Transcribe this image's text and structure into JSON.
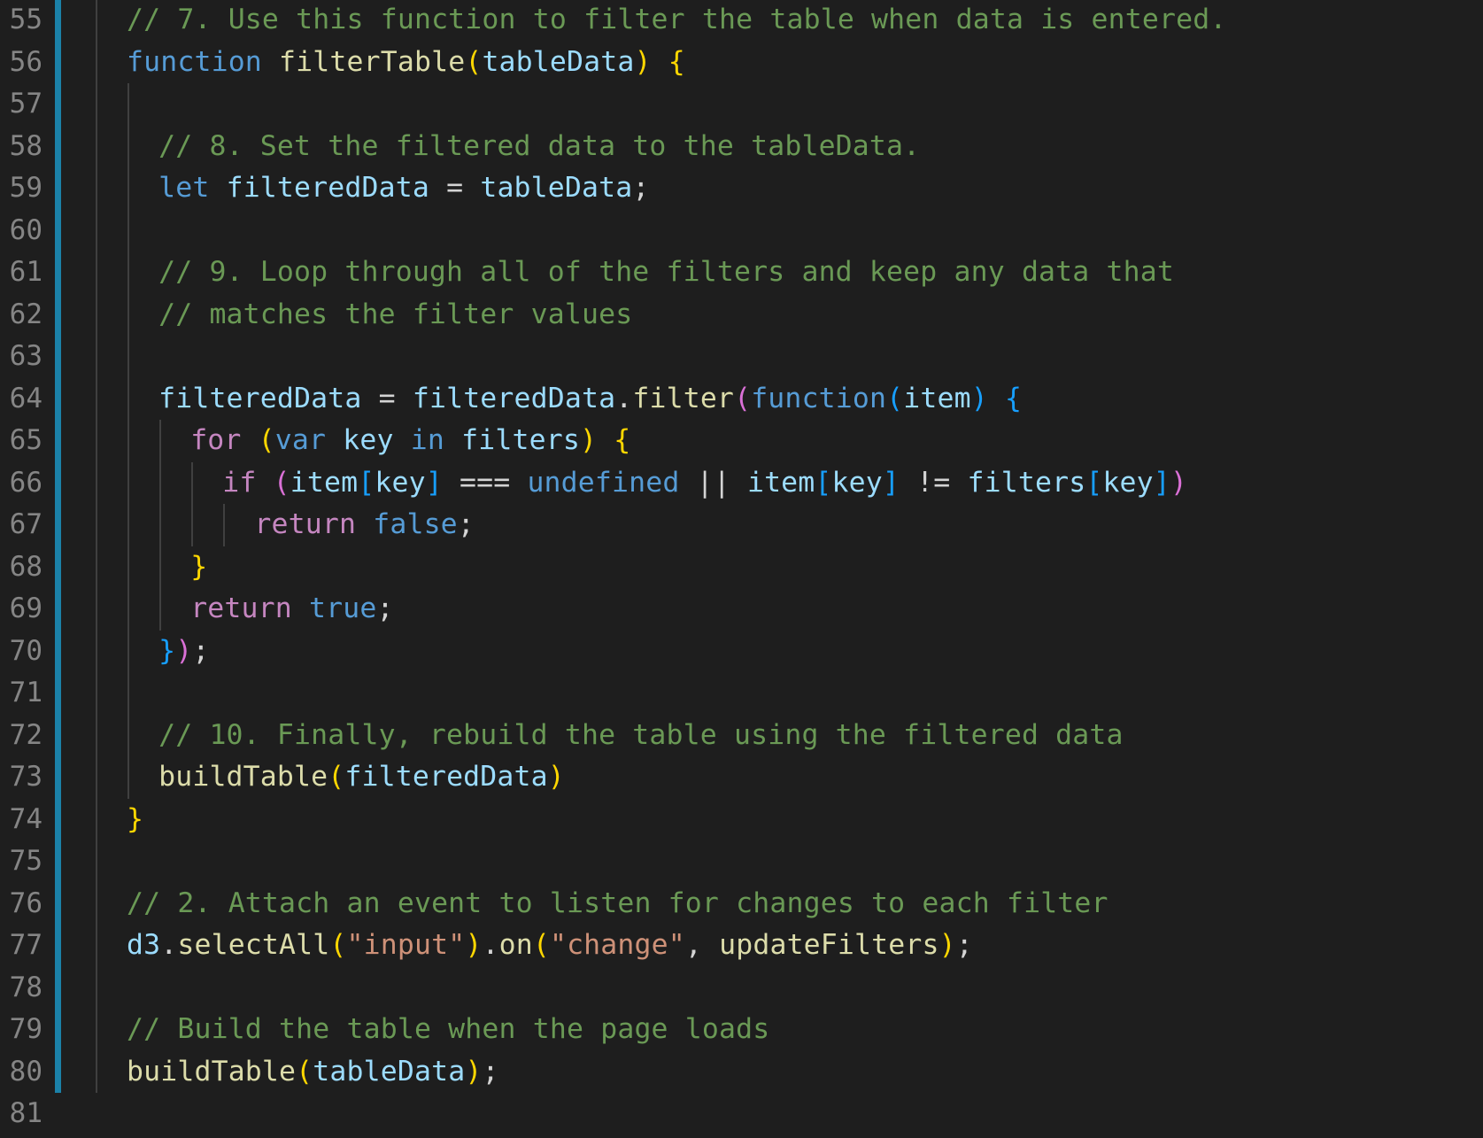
{
  "editor": {
    "colors": {
      "background": "#1e1e1e",
      "comment": "#6a9955",
      "keyword": "#569cd6",
      "control": "#c586c0",
      "variable": "#9cdcfe",
      "function": "#dcdcaa",
      "string": "#ce9178",
      "line_number": "#858585",
      "modified_gutter": "#1b81a8"
    },
    "lines": [
      {
        "num": "55",
        "gutter": "modified",
        "indent": 1,
        "tokens": [
          {
            "t": "c",
            "v": "// 7. Use this function to filter the table when data is entered."
          }
        ]
      },
      {
        "num": "56",
        "gutter": "modified",
        "indent": 1,
        "tokens": [
          {
            "t": "k",
            "v": "function"
          },
          {
            "t": "p",
            "v": " "
          },
          {
            "t": "f",
            "v": "filterTable"
          },
          {
            "t": "b1",
            "v": "("
          },
          {
            "t": "v",
            "v": "tableData"
          },
          {
            "t": "b1",
            "v": ")"
          },
          {
            "t": "p",
            "v": " "
          },
          {
            "t": "b1",
            "v": "{"
          }
        ]
      },
      {
        "num": "57",
        "gutter": "modified",
        "indent": 2,
        "tokens": []
      },
      {
        "num": "58",
        "gutter": "modified",
        "indent": 2,
        "tokens": [
          {
            "t": "c",
            "v": "// 8. Set the filtered data to the tableData."
          }
        ]
      },
      {
        "num": "59",
        "gutter": "modified",
        "indent": 2,
        "tokens": [
          {
            "t": "k",
            "v": "let"
          },
          {
            "t": "p",
            "v": " "
          },
          {
            "t": "v",
            "v": "filteredData"
          },
          {
            "t": "p",
            "v": " = "
          },
          {
            "t": "v",
            "v": "tableData"
          },
          {
            "t": "p",
            "v": ";"
          }
        ]
      },
      {
        "num": "60",
        "gutter": "modified",
        "indent": 2,
        "tokens": []
      },
      {
        "num": "61",
        "gutter": "modified",
        "indent": 2,
        "tokens": [
          {
            "t": "c",
            "v": "// 9. Loop through all of the filters and keep any data that"
          }
        ]
      },
      {
        "num": "62",
        "gutter": "modified",
        "indent": 2,
        "tokens": [
          {
            "t": "c",
            "v": "// matches the filter values"
          }
        ]
      },
      {
        "num": "63",
        "gutter": "modified",
        "indent": 2,
        "tokens": []
      },
      {
        "num": "64",
        "gutter": "modified",
        "indent": 2,
        "tokens": [
          {
            "t": "v",
            "v": "filteredData"
          },
          {
            "t": "p",
            "v": " = "
          },
          {
            "t": "v",
            "v": "filteredData"
          },
          {
            "t": "p",
            "v": "."
          },
          {
            "t": "f",
            "v": "filter"
          },
          {
            "t": "b2",
            "v": "("
          },
          {
            "t": "k",
            "v": "function"
          },
          {
            "t": "b3",
            "v": "("
          },
          {
            "t": "v",
            "v": "item"
          },
          {
            "t": "b3",
            "v": ")"
          },
          {
            "t": "p",
            "v": " "
          },
          {
            "t": "b3",
            "v": "{"
          }
        ]
      },
      {
        "num": "65",
        "gutter": "modified",
        "indent": 3,
        "tokens": [
          {
            "t": "kc",
            "v": "for"
          },
          {
            "t": "p",
            "v": " "
          },
          {
            "t": "b1",
            "v": "("
          },
          {
            "t": "k",
            "v": "var"
          },
          {
            "t": "p",
            "v": " "
          },
          {
            "t": "v",
            "v": "key"
          },
          {
            "t": "p",
            "v": " "
          },
          {
            "t": "k",
            "v": "in"
          },
          {
            "t": "p",
            "v": " "
          },
          {
            "t": "v",
            "v": "filters"
          },
          {
            "t": "b1",
            "v": ")"
          },
          {
            "t": "p",
            "v": " "
          },
          {
            "t": "b1",
            "v": "{"
          }
        ]
      },
      {
        "num": "66",
        "gutter": "modified",
        "indent": 4,
        "tokens": [
          {
            "t": "kc",
            "v": "if"
          },
          {
            "t": "p",
            "v": " "
          },
          {
            "t": "b2",
            "v": "("
          },
          {
            "t": "v",
            "v": "item"
          },
          {
            "t": "b3",
            "v": "["
          },
          {
            "t": "v",
            "v": "key"
          },
          {
            "t": "b3",
            "v": "]"
          },
          {
            "t": "p",
            "v": " === "
          },
          {
            "t": "k",
            "v": "undefined"
          },
          {
            "t": "p",
            "v": " || "
          },
          {
            "t": "v",
            "v": "item"
          },
          {
            "t": "b3",
            "v": "["
          },
          {
            "t": "v",
            "v": "key"
          },
          {
            "t": "b3",
            "v": "]"
          },
          {
            "t": "p",
            "v": " != "
          },
          {
            "t": "v",
            "v": "filters"
          },
          {
            "t": "b3",
            "v": "["
          },
          {
            "t": "v",
            "v": "key"
          },
          {
            "t": "b3",
            "v": "]"
          },
          {
            "t": "b2",
            "v": ")"
          }
        ]
      },
      {
        "num": "67",
        "gutter": "modified",
        "indent": 5,
        "tokens": [
          {
            "t": "kc",
            "v": "return"
          },
          {
            "t": "p",
            "v": " "
          },
          {
            "t": "k",
            "v": "false"
          },
          {
            "t": "p",
            "v": ";"
          }
        ]
      },
      {
        "num": "68",
        "gutter": "modified",
        "indent": 3,
        "tokens": [
          {
            "t": "b1",
            "v": "}"
          }
        ]
      },
      {
        "num": "69",
        "gutter": "modified",
        "indent": 3,
        "tokens": [
          {
            "t": "kc",
            "v": "return"
          },
          {
            "t": "p",
            "v": " "
          },
          {
            "t": "k",
            "v": "true"
          },
          {
            "t": "p",
            "v": ";"
          }
        ]
      },
      {
        "num": "70",
        "gutter": "modified",
        "indent": 2,
        "tokens": [
          {
            "t": "b3",
            "v": "}"
          },
          {
            "t": "b2",
            "v": ")"
          },
          {
            "t": "p",
            "v": ";"
          }
        ]
      },
      {
        "num": "71",
        "gutter": "modified",
        "indent": 2,
        "tokens": []
      },
      {
        "num": "72",
        "gutter": "modified",
        "indent": 2,
        "tokens": [
          {
            "t": "c",
            "v": "// 10. Finally, rebuild the table using the filtered data"
          }
        ]
      },
      {
        "num": "73",
        "gutter": "modified",
        "indent": 2,
        "tokens": [
          {
            "t": "f",
            "v": "buildTable"
          },
          {
            "t": "b1",
            "v": "("
          },
          {
            "t": "v",
            "v": "filteredData"
          },
          {
            "t": "b1",
            "v": ")"
          }
        ]
      },
      {
        "num": "74",
        "gutter": "modified",
        "indent": 1,
        "tokens": [
          {
            "t": "b1",
            "v": "}"
          }
        ]
      },
      {
        "num": "75",
        "gutter": "modified",
        "indent": 1,
        "tokens": []
      },
      {
        "num": "76",
        "gutter": "modified",
        "indent": 1,
        "tokens": [
          {
            "t": "c",
            "v": "// 2. Attach an event to listen for changes to each filter"
          }
        ]
      },
      {
        "num": "77",
        "gutter": "modified",
        "indent": 1,
        "tokens": [
          {
            "t": "v",
            "v": "d3"
          },
          {
            "t": "p",
            "v": "."
          },
          {
            "t": "f",
            "v": "selectAll"
          },
          {
            "t": "b1",
            "v": "("
          },
          {
            "t": "s",
            "v": "\"input\""
          },
          {
            "t": "b1",
            "v": ")"
          },
          {
            "t": "p",
            "v": "."
          },
          {
            "t": "f",
            "v": "on"
          },
          {
            "t": "b1",
            "v": "("
          },
          {
            "t": "s",
            "v": "\"change\""
          },
          {
            "t": "p",
            "v": ", "
          },
          {
            "t": "f",
            "v": "updateFilters"
          },
          {
            "t": "b1",
            "v": ")"
          },
          {
            "t": "p",
            "v": ";"
          }
        ]
      },
      {
        "num": "78",
        "gutter": "modified",
        "indent": 1,
        "tokens": []
      },
      {
        "num": "79",
        "gutter": "modified",
        "indent": 1,
        "tokens": [
          {
            "t": "c",
            "v": "// Build the table when the page loads"
          }
        ]
      },
      {
        "num": "80",
        "gutter": "modified",
        "indent": 1,
        "tokens": [
          {
            "t": "f",
            "v": "buildTable"
          },
          {
            "t": "b1",
            "v": "("
          },
          {
            "t": "v",
            "v": "tableData"
          },
          {
            "t": "b1",
            "v": ")"
          },
          {
            "t": "p",
            "v": ";"
          }
        ]
      },
      {
        "num": "81",
        "gutter": "none",
        "indent": 0,
        "tokens": []
      }
    ]
  }
}
